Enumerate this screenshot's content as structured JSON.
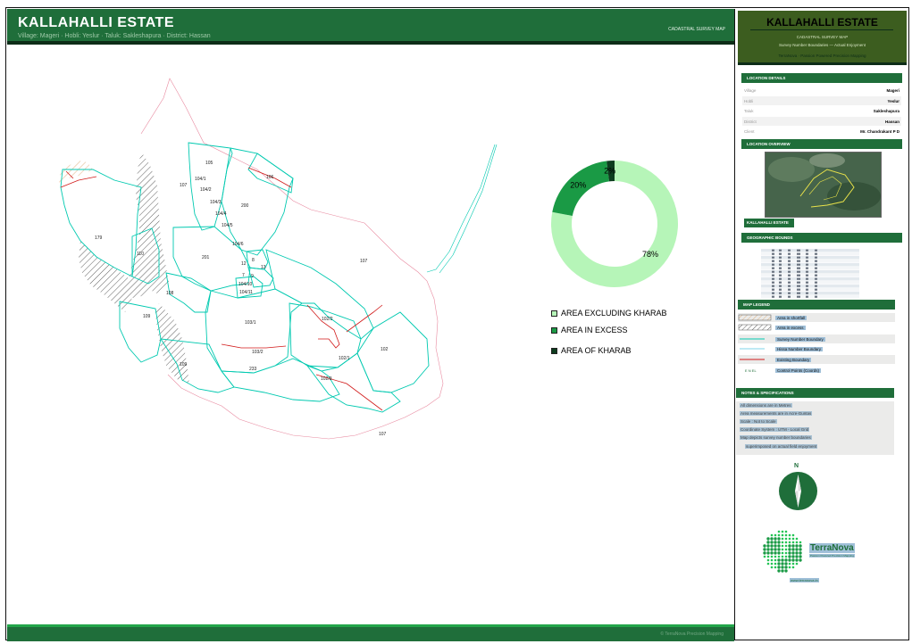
{
  "header": {
    "title": "KALLAHALLI ESTATE",
    "subtitle": "Village: Mageri  ·  Hobli: Yeslur  ·  Taluk: Sakleshapura  ·  District: Hassan",
    "tag": "CADASTRAL SURVEY MAP"
  },
  "sidebar": {
    "title": "KALLAHALLI ESTATE",
    "map_type": "CADASTRAL SURVEY MAP",
    "description": "Survey Number Boundaries — Actual Enjoyment",
    "brand_line": "TerraNova  ·  Passion Powered Precision Mapping",
    "location_header": "LOCATION DETAILS",
    "location": [
      {
        "key": "Village",
        "value": "Mageri"
      },
      {
        "key": "Hobli",
        "value": "Yeslur"
      },
      {
        "key": "Taluk",
        "value": "Sakleshapura"
      },
      {
        "key": "District",
        "value": "Hassan"
      },
      {
        "key": "Client",
        "value": "Mr. Chandrakant P D"
      }
    ],
    "overview_header": "LOCATION OVERVIEW",
    "overview_label": "KALLAHALLI ESTATE",
    "bounds_header": "GEOGRAPHIC BOUNDS",
    "legend_header": "MAP LEGEND",
    "legend": [
      {
        "label": "Area in shortfall",
        "style": "hatch-orange"
      },
      {
        "label": "Area in excess",
        "style": "hatch-black"
      },
      {
        "label": "Survey Number Boundary",
        "style": "line-cyan"
      },
      {
        "label": "Hissa Number Boundary",
        "style": "line-lightblue"
      },
      {
        "label": "Existing Boundary",
        "style": "line-red"
      },
      {
        "label": "Control Points (Coords)",
        "style": "point"
      }
    ],
    "legend_point_symbol": "E N EL",
    "notes_header": "NOTES & SPECIFICATIONS",
    "notes": [
      "All dimensions are in Metres",
      "Area measurements are in Acre-Guntas",
      "Scale : Not to Scale",
      "Coordinate System : UTM - Local Grid",
      "Map depicts survey number boundaries",
      "superimposed on actual field enjoyment"
    ],
    "north_label": "N",
    "logo_name": "TerraNova",
    "logo_tagline": "Passion Powered Precision Mapping",
    "website": "www.terranova.in"
  },
  "footer": {
    "note": "© TerraNova Precision Mapping"
  },
  "colors": {
    "brand_green": "#1f6e3a",
    "dark_green": "#0d2d18",
    "survey_boundary": "#00c9b0",
    "existing_boundary": "#d11a1a",
    "outer_boundary": "#e88aa0"
  },
  "parcels": [
    "105",
    "106",
    "107",
    "104/1",
    "104/2",
    "104/3",
    "104/4",
    "104/5",
    "104/6",
    "200",
    "179",
    "110",
    "201",
    "8",
    "12",
    "13",
    "7",
    "9",
    "104/10",
    "104/11",
    "108",
    "109",
    "103/1",
    "102/2",
    "103/2",
    "102/1",
    "102",
    "109",
    "233",
    "102/3",
    "107",
    "107"
  ],
  "chart_data": {
    "type": "pie",
    "variant": "donut",
    "categories": [
      "AREA EXCLUDING KHARAB",
      "AREA IN EXCESS",
      "AREA OF KHARAB"
    ],
    "values": [
      78,
      20,
      2
    ],
    "value_labels": [
      "78%",
      "20%",
      "2%"
    ],
    "colors": [
      "#b6f5b8",
      "#1a9a45",
      "#0d3d1f"
    ],
    "legend_position": "bottom"
  }
}
